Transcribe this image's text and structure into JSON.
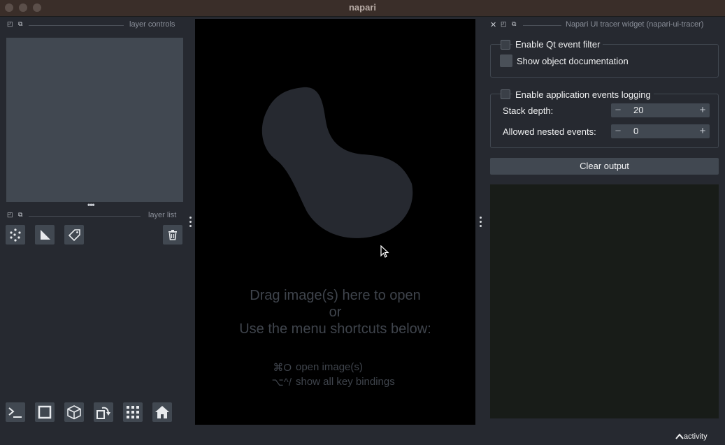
{
  "window": {
    "title": "napari"
  },
  "left_dock": {
    "controls_label": "layer controls",
    "list_label": "layer list"
  },
  "layer_tools": [
    {
      "name": "new-points-button",
      "icon": "points-icon"
    },
    {
      "name": "new-shapes-button",
      "icon": "shapes-icon"
    },
    {
      "name": "new-labels-button",
      "icon": "labels-icon"
    }
  ],
  "bottom_tools": [
    {
      "name": "console-button",
      "icon": "console-icon"
    },
    {
      "name": "ndisplay-button",
      "icon": "square-icon"
    },
    {
      "name": "roll-dims-button",
      "icon": "cube-icon"
    },
    {
      "name": "transpose-button",
      "icon": "rotate-icon"
    },
    {
      "name": "grid-button",
      "icon": "grid-icon"
    },
    {
      "name": "home-button",
      "icon": "home-icon"
    }
  ],
  "canvas": {
    "welcome_line1": "Drag image(s) here to open",
    "welcome_line2": "or",
    "welcome_line3": "Use the menu shortcuts below:",
    "shortcuts": [
      {
        "key": "⌘O",
        "desc": "open image(s)"
      },
      {
        "key": "⌥^/",
        "desc": "show all key bindings"
      }
    ]
  },
  "tracer": {
    "title": "Napari UI tracer widget (napari-ui-tracer)",
    "qt_filter_label": "Enable Qt event filter",
    "show_doc_label": "Show object documentation",
    "app_logging_label": "Enable application events logging",
    "stack_depth_label": "Stack depth:",
    "stack_depth_value": "20",
    "nested_label": "Allowed nested events:",
    "nested_value": "0",
    "clear_label": "Clear output"
  },
  "status": {
    "activity_label": "activity"
  },
  "colors": {
    "background": "#262930",
    "panel": "#414851",
    "canvas": "#000000",
    "blob": "#262930"
  }
}
